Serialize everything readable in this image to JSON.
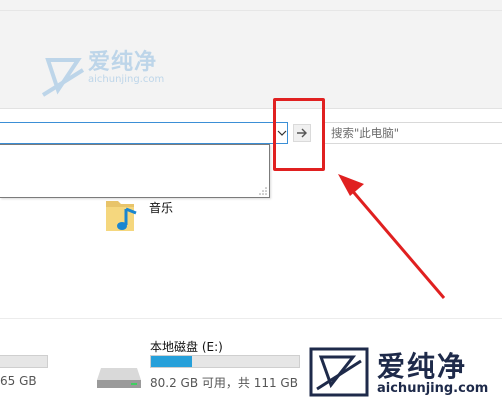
{
  "search": {
    "placeholder": "搜索\"此电脑\""
  },
  "folders": [
    {
      "label": "音乐",
      "icon": "music-folder-icon"
    }
  ],
  "drives": {
    "left": {
      "text": "65 GB",
      "fill_fraction": 0.6
    },
    "e": {
      "name": "本地磁盘 (E:)",
      "detail": "80.2 GB 可用，共 111 GB",
      "fill_fraction": 0.28
    }
  },
  "watermark": {
    "text": "爱纯净",
    "sub": "aichunjing.com"
  },
  "colors": {
    "highlight": "#e02020",
    "drive_fill": "#26a0da",
    "address_focus": "#3b8fd6"
  }
}
